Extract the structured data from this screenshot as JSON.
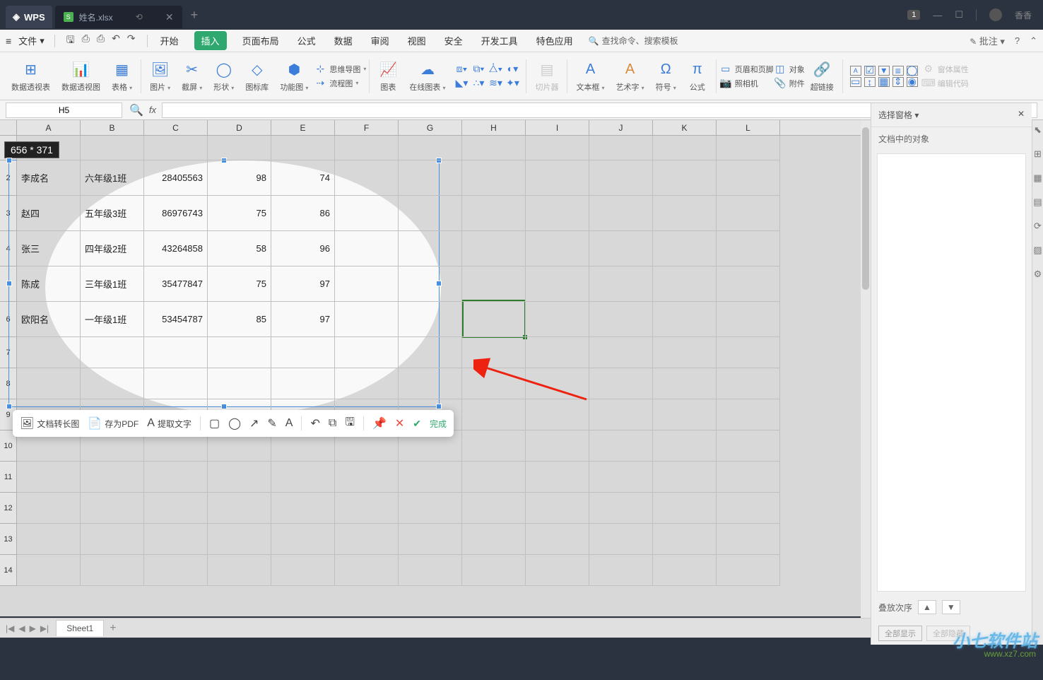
{
  "titlebar": {
    "app_name": "WPS",
    "tab_name": "姓名.xlsx",
    "tab_add": "+",
    "badge": "1",
    "user": "香香"
  },
  "menubar": {
    "file": "文件",
    "tabs": [
      "开始",
      "插入",
      "页面布局",
      "公式",
      "数据",
      "审阅",
      "视图",
      "安全",
      "开发工具",
      "特色应用"
    ],
    "active_tab_index": 1,
    "search": "查找命令、搜索模板",
    "annotate": "批注"
  },
  "ribbon": {
    "pivot_table": "数据透视表",
    "pivot_chart": "数据透视图",
    "table": "表格",
    "picture": "图片",
    "screenshot": "截屏",
    "shapes": "形状",
    "icons_lib": "图标库",
    "smart_graphic": "功能图",
    "mindmap": "思维导图",
    "flowchart": "流程图",
    "chart": "图表",
    "online_chart": "在线图表",
    "slicer": "切片器",
    "textbox": "文本框",
    "wordart": "艺术字",
    "symbol": "符号",
    "equation": "公式",
    "camera": "照相机",
    "hyperlink": "超链接",
    "header_footer": "页眉和页脚",
    "object": "对象",
    "attachment": "附件",
    "form_controls": "窗体属性",
    "edit_code": "编辑代码"
  },
  "formula_bar": {
    "cell_ref": "H5"
  },
  "columns": [
    "A",
    "B",
    "C",
    "D",
    "E",
    "F",
    "G",
    "H",
    "I",
    "J",
    "K",
    "L"
  ],
  "rows": [
    2,
    3,
    4,
    5,
    6,
    7,
    8,
    9,
    10,
    11,
    12,
    13,
    14
  ],
  "table_data": [
    {
      "name": "李成名",
      "class": "六年级1班",
      "id": "28405563",
      "score1": "98",
      "score2": "74"
    },
    {
      "name": "赵四",
      "class": "五年级3班",
      "id": "86976743",
      "score1": "75",
      "score2": "86"
    },
    {
      "name": "张三",
      "class": "四年级2班",
      "id": "43264858",
      "score1": "58",
      "score2": "96"
    },
    {
      "name": "陈成",
      "class": "三年级1班",
      "id": "35477847",
      "score1": "75",
      "score2": "97"
    },
    {
      "name": "欧阳名",
      "class": "一年级1班",
      "id": "53454787",
      "score1": "85",
      "score2": "97"
    }
  ],
  "selection_dim": "656 * 371",
  "screenshot_toolbar": {
    "long_screenshot": "文档转长图",
    "save_pdf": "存为PDF",
    "extract_text": "提取文字",
    "done": "完成"
  },
  "side_panel": {
    "title": "选择窗格",
    "subtitle": "文档中的对象",
    "layer_order": "叠放次序",
    "show_all": "全部显示",
    "hide_all": "全部隐藏"
  },
  "sheet_tab": "Sheet1",
  "watermark": {
    "brand": "小七软件站",
    "url": "www.xz7.com"
  }
}
